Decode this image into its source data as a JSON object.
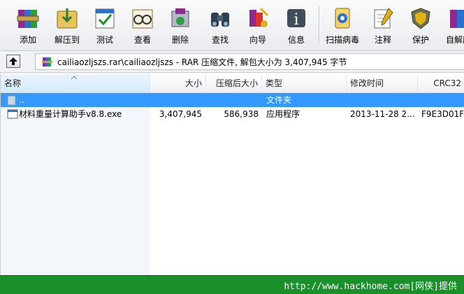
{
  "toolbar": {
    "buttons": [
      {
        "label": "添加"
      },
      {
        "label": "解压到"
      },
      {
        "label": "测试"
      },
      {
        "label": "查看"
      },
      {
        "label": "删除"
      },
      {
        "label": "查找"
      },
      {
        "label": "向导"
      },
      {
        "label": "信息"
      },
      {
        "label": "扫描病毒"
      },
      {
        "label": "注释"
      },
      {
        "label": "保护"
      },
      {
        "label": "自解压"
      }
    ]
  },
  "address": {
    "path": "cailiaozljszs.rar\\cailiaozljszs - RAR 压缩文件, 解包大小为 3,407,945 字节"
  },
  "columns": {
    "name": "名称",
    "size": "大小",
    "packed": "压缩后大小",
    "type": "类型",
    "modified": "修改时间",
    "crc": "CRC32"
  },
  "rows": [
    {
      "name": "..",
      "size": "",
      "packed": "",
      "type": "文件夹",
      "modified": "",
      "crc": ""
    },
    {
      "name": "材料重量计算助手v8.8.exe",
      "size": "3,407,945",
      "packed": "586,938",
      "type": "应用程序",
      "modified": "2013-11-28 2...",
      "crc": "F9E3D01F"
    }
  ],
  "watermark": "http://www.hackhome.com[网侠]提供",
  "colors": {
    "selection": "#3399ff",
    "status_bg": "#1a8f2a"
  }
}
